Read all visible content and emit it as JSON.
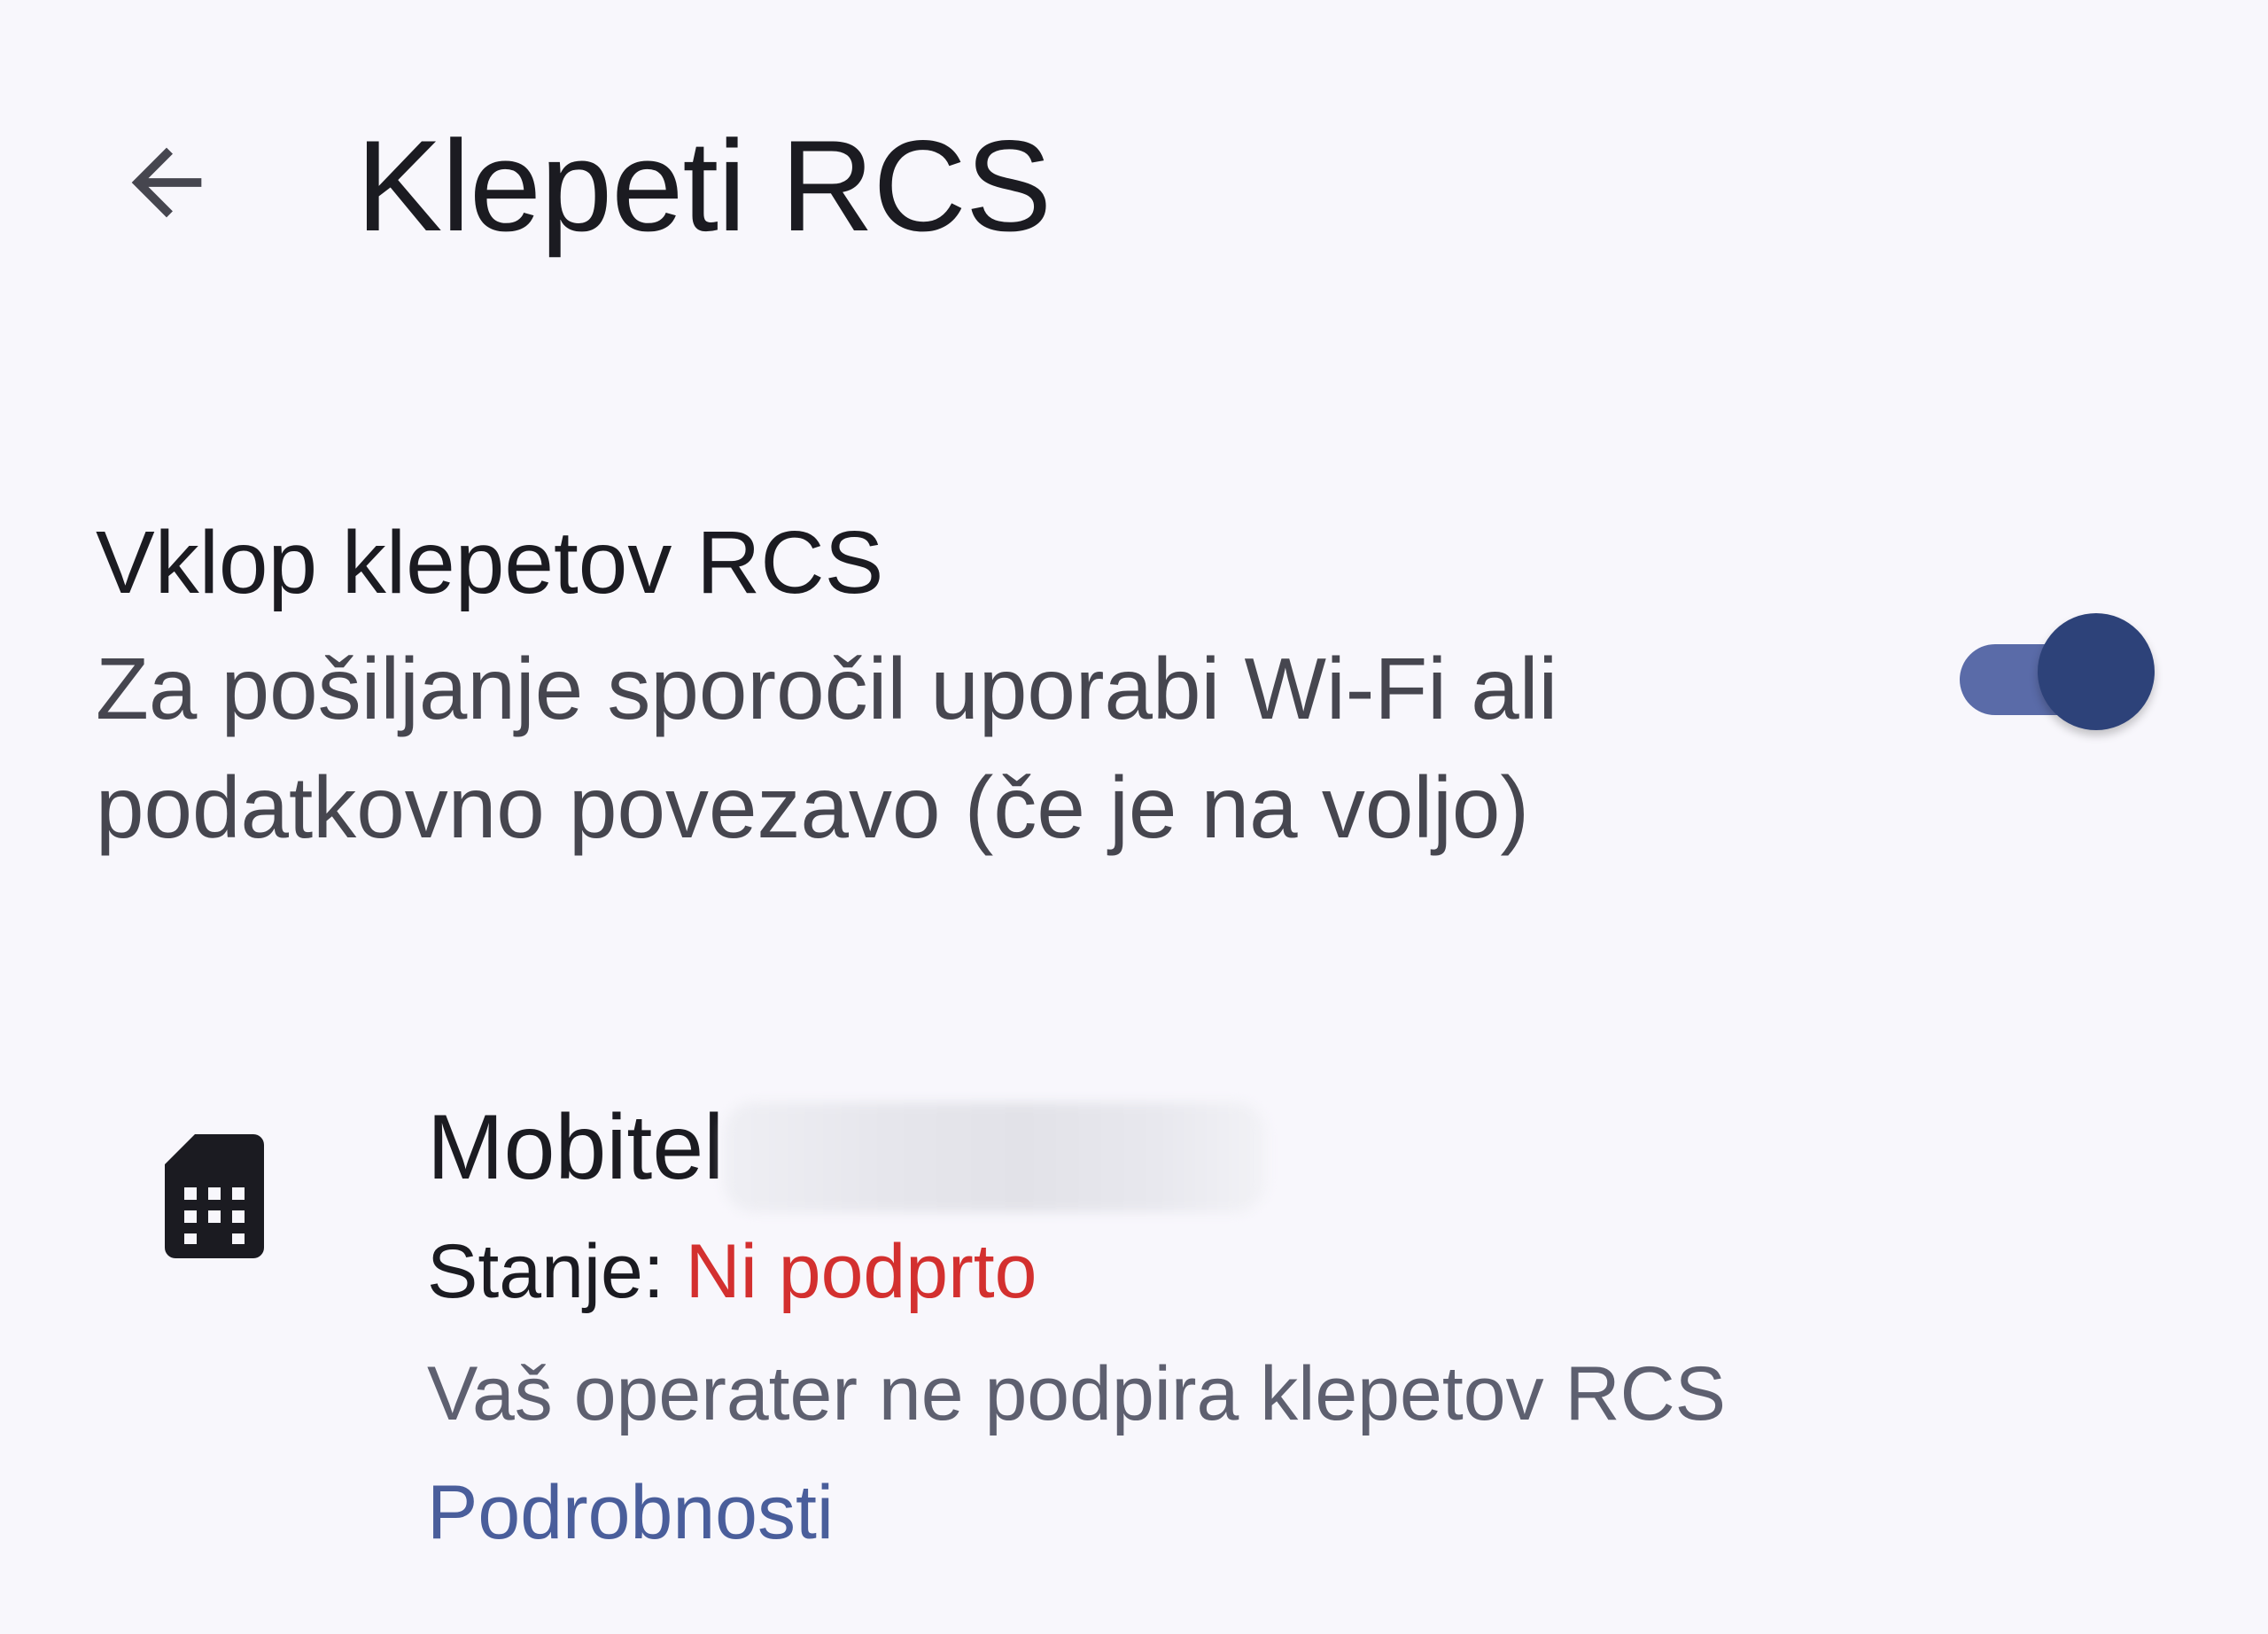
{
  "app_bar": {
    "back_icon": "arrow-back-icon",
    "title": "Klepeti RCS"
  },
  "rcs_setting": {
    "title": "Vklop klepetov RCS",
    "summary": "Za pošiljanje sporočil uporabi Wi-Fi ali podatkovno povezavo (če je na voljo)",
    "enabled": true
  },
  "sim": {
    "icon": "sim-card-icon",
    "carrier": "Mobitel",
    "phone_number_redacted": true,
    "status_label": "Stanje:",
    "status_value": "Ni podprto",
    "message": "Vaš operater ne podpira klepetov RCS",
    "details_link": "Podrobnosti"
  },
  "colors": {
    "background": "#f8f7fc",
    "switch_track": "#5a6ba8",
    "switch_thumb": "#2d4279",
    "status_error": "#d3302f",
    "link": "#4a5e9b"
  }
}
